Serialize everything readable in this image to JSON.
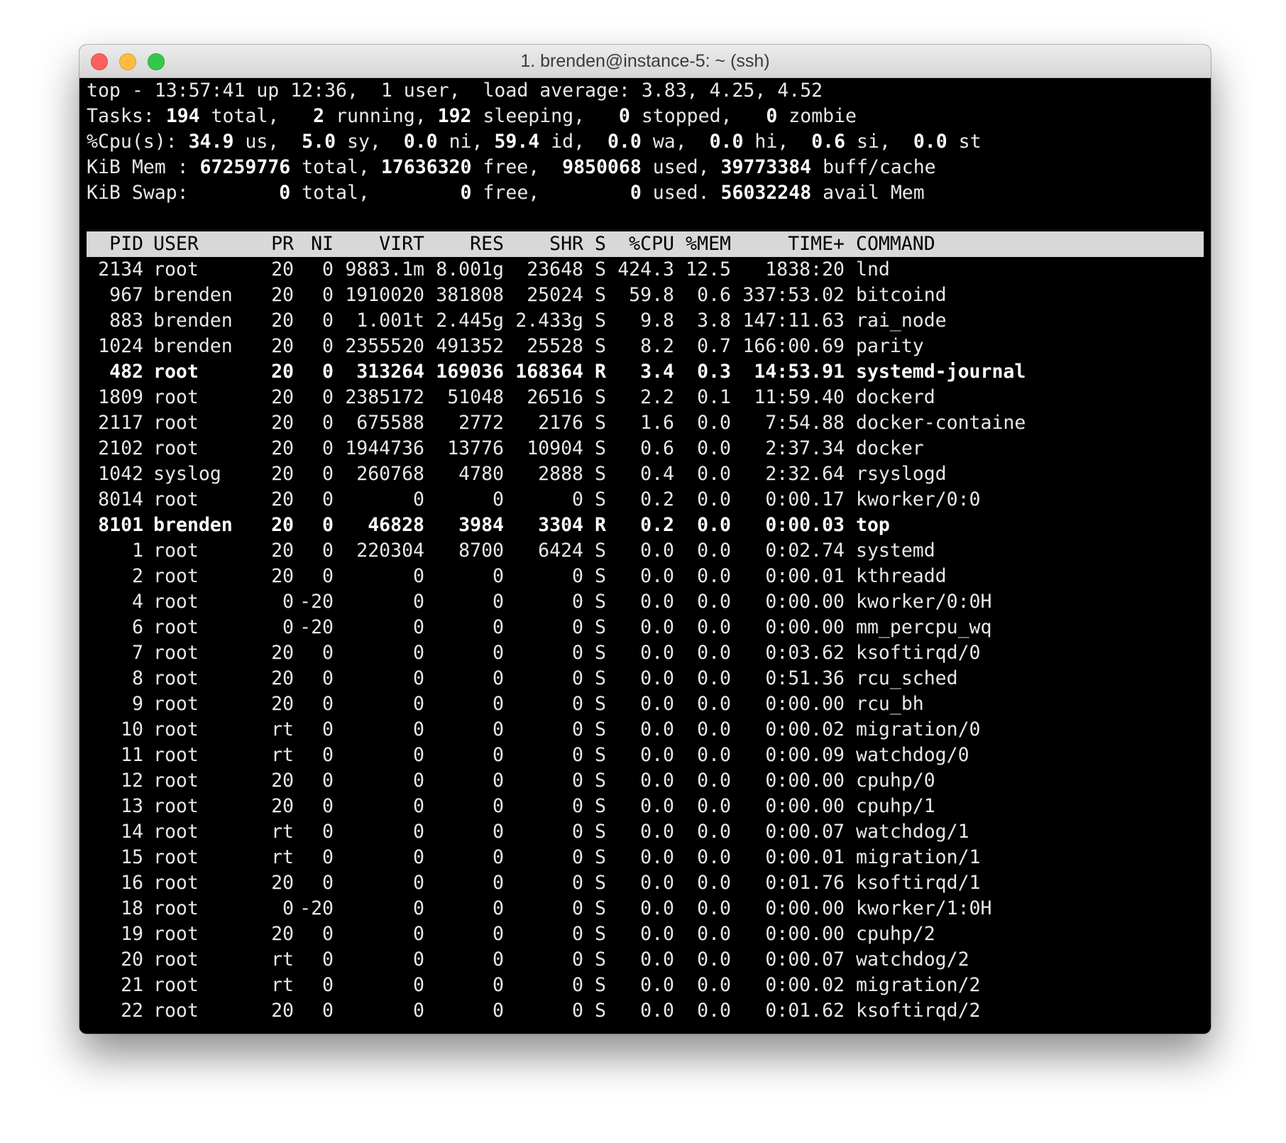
{
  "window": {
    "title": "1. brenden@instance-5: ~ (ssh)"
  },
  "summary": {
    "top": {
      "time": "13:57:41",
      "uptime": "12:36",
      "users": "1",
      "load": "3.83, 4.25, 4.52"
    },
    "tasks": {
      "total": "194",
      "running": "2",
      "sleeping": "192",
      "stopped": "0",
      "zombie": "0"
    },
    "cpu": {
      "us": "34.9",
      "sy": "5.0",
      "ni": "0.0",
      "id": "59.4",
      "wa": "0.0",
      "hi": "0.0",
      "si": "0.6",
      "st": "0.0"
    },
    "mem": {
      "total": "67259776",
      "free": "17636320",
      "used": "9850068",
      "buff": "39773384"
    },
    "swap": {
      "total": "0",
      "free": "0",
      "used": "0",
      "avail": "56032248"
    }
  },
  "columns": [
    "PID",
    "USER",
    "PR",
    "NI",
    "VIRT",
    "RES",
    "SHR",
    "S",
    "%CPU",
    "%MEM",
    "TIME+",
    "COMMAND"
  ],
  "processes": [
    {
      "pid": "2134",
      "user": "root",
      "pr": "20",
      "ni": "0",
      "virt": "9883.1m",
      "res": "8.001g",
      "shr": "23648",
      "s": "S",
      "cpu": "424.3",
      "mem": "12.5",
      "time": "1838:20",
      "cmd": "lnd",
      "bold": false
    },
    {
      "pid": "967",
      "user": "brenden",
      "pr": "20",
      "ni": "0",
      "virt": "1910020",
      "res": "381808",
      "shr": "25024",
      "s": "S",
      "cpu": "59.8",
      "mem": "0.6",
      "time": "337:53.02",
      "cmd": "bitcoind",
      "bold": false
    },
    {
      "pid": "883",
      "user": "brenden",
      "pr": "20",
      "ni": "0",
      "virt": "1.001t",
      "res": "2.445g",
      "shr": "2.433g",
      "s": "S",
      "cpu": "9.8",
      "mem": "3.8",
      "time": "147:11.63",
      "cmd": "rai_node",
      "bold": false
    },
    {
      "pid": "1024",
      "user": "brenden",
      "pr": "20",
      "ni": "0",
      "virt": "2355520",
      "res": "491352",
      "shr": "25528",
      "s": "S",
      "cpu": "8.2",
      "mem": "0.7",
      "time": "166:00.69",
      "cmd": "parity",
      "bold": false
    },
    {
      "pid": "482",
      "user": "root",
      "pr": "20",
      "ni": "0",
      "virt": "313264",
      "res": "169036",
      "shr": "168364",
      "s": "R",
      "cpu": "3.4",
      "mem": "0.3",
      "time": "14:53.91",
      "cmd": "systemd-journal",
      "bold": true
    },
    {
      "pid": "1809",
      "user": "root",
      "pr": "20",
      "ni": "0",
      "virt": "2385172",
      "res": "51048",
      "shr": "26516",
      "s": "S",
      "cpu": "2.2",
      "mem": "0.1",
      "time": "11:59.40",
      "cmd": "dockerd",
      "bold": false
    },
    {
      "pid": "2117",
      "user": "root",
      "pr": "20",
      "ni": "0",
      "virt": "675588",
      "res": "2772",
      "shr": "2176",
      "s": "S",
      "cpu": "1.6",
      "mem": "0.0",
      "time": "7:54.88",
      "cmd": "docker-containe",
      "bold": false
    },
    {
      "pid": "2102",
      "user": "root",
      "pr": "20",
      "ni": "0",
      "virt": "1944736",
      "res": "13776",
      "shr": "10904",
      "s": "S",
      "cpu": "0.6",
      "mem": "0.0",
      "time": "2:37.34",
      "cmd": "docker",
      "bold": false
    },
    {
      "pid": "1042",
      "user": "syslog",
      "pr": "20",
      "ni": "0",
      "virt": "260768",
      "res": "4780",
      "shr": "2888",
      "s": "S",
      "cpu": "0.4",
      "mem": "0.0",
      "time": "2:32.64",
      "cmd": "rsyslogd",
      "bold": false
    },
    {
      "pid": "8014",
      "user": "root",
      "pr": "20",
      "ni": "0",
      "virt": "0",
      "res": "0",
      "shr": "0",
      "s": "S",
      "cpu": "0.2",
      "mem": "0.0",
      "time": "0:00.17",
      "cmd": "kworker/0:0",
      "bold": false
    },
    {
      "pid": "8101",
      "user": "brenden",
      "pr": "20",
      "ni": "0",
      "virt": "46828",
      "res": "3984",
      "shr": "3304",
      "s": "R",
      "cpu": "0.2",
      "mem": "0.0",
      "time": "0:00.03",
      "cmd": "top",
      "bold": true
    },
    {
      "pid": "1",
      "user": "root",
      "pr": "20",
      "ni": "0",
      "virt": "220304",
      "res": "8700",
      "shr": "6424",
      "s": "S",
      "cpu": "0.0",
      "mem": "0.0",
      "time": "0:02.74",
      "cmd": "systemd",
      "bold": false
    },
    {
      "pid": "2",
      "user": "root",
      "pr": "20",
      "ni": "0",
      "virt": "0",
      "res": "0",
      "shr": "0",
      "s": "S",
      "cpu": "0.0",
      "mem": "0.0",
      "time": "0:00.01",
      "cmd": "kthreadd",
      "bold": false
    },
    {
      "pid": "4",
      "user": "root",
      "pr": "0",
      "ni": "-20",
      "virt": "0",
      "res": "0",
      "shr": "0",
      "s": "S",
      "cpu": "0.0",
      "mem": "0.0",
      "time": "0:00.00",
      "cmd": "kworker/0:0H",
      "bold": false
    },
    {
      "pid": "6",
      "user": "root",
      "pr": "0",
      "ni": "-20",
      "virt": "0",
      "res": "0",
      "shr": "0",
      "s": "S",
      "cpu": "0.0",
      "mem": "0.0",
      "time": "0:00.00",
      "cmd": "mm_percpu_wq",
      "bold": false
    },
    {
      "pid": "7",
      "user": "root",
      "pr": "20",
      "ni": "0",
      "virt": "0",
      "res": "0",
      "shr": "0",
      "s": "S",
      "cpu": "0.0",
      "mem": "0.0",
      "time": "0:03.62",
      "cmd": "ksoftirqd/0",
      "bold": false
    },
    {
      "pid": "8",
      "user": "root",
      "pr": "20",
      "ni": "0",
      "virt": "0",
      "res": "0",
      "shr": "0",
      "s": "S",
      "cpu": "0.0",
      "mem": "0.0",
      "time": "0:51.36",
      "cmd": "rcu_sched",
      "bold": false
    },
    {
      "pid": "9",
      "user": "root",
      "pr": "20",
      "ni": "0",
      "virt": "0",
      "res": "0",
      "shr": "0",
      "s": "S",
      "cpu": "0.0",
      "mem": "0.0",
      "time": "0:00.00",
      "cmd": "rcu_bh",
      "bold": false
    },
    {
      "pid": "10",
      "user": "root",
      "pr": "rt",
      "ni": "0",
      "virt": "0",
      "res": "0",
      "shr": "0",
      "s": "S",
      "cpu": "0.0",
      "mem": "0.0",
      "time": "0:00.02",
      "cmd": "migration/0",
      "bold": false
    },
    {
      "pid": "11",
      "user": "root",
      "pr": "rt",
      "ni": "0",
      "virt": "0",
      "res": "0",
      "shr": "0",
      "s": "S",
      "cpu": "0.0",
      "mem": "0.0",
      "time": "0:00.09",
      "cmd": "watchdog/0",
      "bold": false
    },
    {
      "pid": "12",
      "user": "root",
      "pr": "20",
      "ni": "0",
      "virt": "0",
      "res": "0",
      "shr": "0",
      "s": "S",
      "cpu": "0.0",
      "mem": "0.0",
      "time": "0:00.00",
      "cmd": "cpuhp/0",
      "bold": false
    },
    {
      "pid": "13",
      "user": "root",
      "pr": "20",
      "ni": "0",
      "virt": "0",
      "res": "0",
      "shr": "0",
      "s": "S",
      "cpu": "0.0",
      "mem": "0.0",
      "time": "0:00.00",
      "cmd": "cpuhp/1",
      "bold": false
    },
    {
      "pid": "14",
      "user": "root",
      "pr": "rt",
      "ni": "0",
      "virt": "0",
      "res": "0",
      "shr": "0",
      "s": "S",
      "cpu": "0.0",
      "mem": "0.0",
      "time": "0:00.07",
      "cmd": "watchdog/1",
      "bold": false
    },
    {
      "pid": "15",
      "user": "root",
      "pr": "rt",
      "ni": "0",
      "virt": "0",
      "res": "0",
      "shr": "0",
      "s": "S",
      "cpu": "0.0",
      "mem": "0.0",
      "time": "0:00.01",
      "cmd": "migration/1",
      "bold": false
    },
    {
      "pid": "16",
      "user": "root",
      "pr": "20",
      "ni": "0",
      "virt": "0",
      "res": "0",
      "shr": "0",
      "s": "S",
      "cpu": "0.0",
      "mem": "0.0",
      "time": "0:01.76",
      "cmd": "ksoftirqd/1",
      "bold": false
    },
    {
      "pid": "18",
      "user": "root",
      "pr": "0",
      "ni": "-20",
      "virt": "0",
      "res": "0",
      "shr": "0",
      "s": "S",
      "cpu": "0.0",
      "mem": "0.0",
      "time": "0:00.00",
      "cmd": "kworker/1:0H",
      "bold": false
    },
    {
      "pid": "19",
      "user": "root",
      "pr": "20",
      "ni": "0",
      "virt": "0",
      "res": "0",
      "shr": "0",
      "s": "S",
      "cpu": "0.0",
      "mem": "0.0",
      "time": "0:00.00",
      "cmd": "cpuhp/2",
      "bold": false
    },
    {
      "pid": "20",
      "user": "root",
      "pr": "rt",
      "ni": "0",
      "virt": "0",
      "res": "0",
      "shr": "0",
      "s": "S",
      "cpu": "0.0",
      "mem": "0.0",
      "time": "0:00.07",
      "cmd": "watchdog/2",
      "bold": false
    },
    {
      "pid": "21",
      "user": "root",
      "pr": "rt",
      "ni": "0",
      "virt": "0",
      "res": "0",
      "shr": "0",
      "s": "S",
      "cpu": "0.0",
      "mem": "0.0",
      "time": "0:00.02",
      "cmd": "migration/2",
      "bold": false
    },
    {
      "pid": "22",
      "user": "root",
      "pr": "20",
      "ni": "0",
      "virt": "0",
      "res": "0",
      "shr": "0",
      "s": "S",
      "cpu": "0.0",
      "mem": "0.0",
      "time": "0:01.62",
      "cmd": "ksoftirqd/2",
      "bold": false
    }
  ]
}
